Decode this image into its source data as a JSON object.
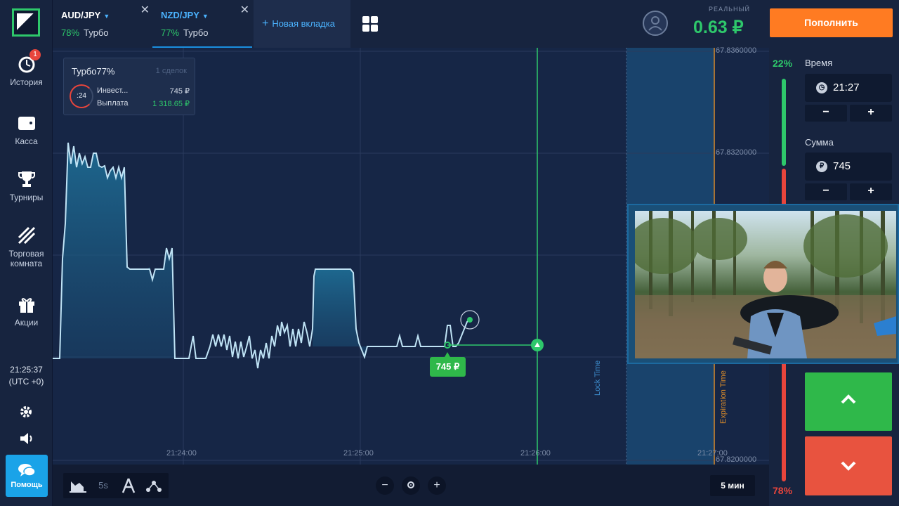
{
  "sidebar": {
    "history_label": "История",
    "history_badge": "1",
    "cashier_label": "Касса",
    "tournaments_label": "Турниры",
    "trading_room_label_1": "Торговая",
    "trading_room_label_2": "комната",
    "promo_label": "Акции",
    "clock_time": "21:25:37",
    "clock_tz": "(UTC +0)",
    "help_label": "Помощь"
  },
  "tabs": [
    {
      "pair": "AUD/JPY",
      "percent": "78%",
      "mode": "Турбо",
      "active": false
    },
    {
      "pair": "NZD/JPY",
      "percent": "77%",
      "mode": "Турбо",
      "active": true
    }
  ],
  "new_tab_label": "Новая вкладка",
  "account": {
    "type_label": "РЕАЛЬНЫЙ",
    "balance": "0.63 ₽"
  },
  "deposit_label": "Пополнить",
  "deal_card": {
    "title": "Турбо77%",
    "count": "1 сделок",
    "timer": ":24",
    "invest_label": "Инвест...",
    "invest_value": "745 ₽",
    "payout_label": "Выплата",
    "payout_value": "1 318.65 ₽"
  },
  "chart_data": {
    "type": "area",
    "price_labels": [
      "67.8360000",
      "67.8320000",
      "67.8200000"
    ],
    "time_labels": [
      "21:24:00",
      "21:25:00",
      "21:26:00",
      "21:27:00"
    ],
    "lock_label": "Lock Time",
    "expiration_label": "Expiration Time",
    "trade_badge": "745 ₽"
  },
  "bottom": {
    "interval_label": "5s",
    "timeframe_label": "5 мин"
  },
  "right_panel": {
    "up_percent": "22%",
    "down_percent": "78%",
    "up_fraction": 0.22,
    "time_label": "Время",
    "time_value": "21:27",
    "amount_label": "Сумма",
    "amount_value": "745",
    "currency_symbol": "₽"
  },
  "colors": {
    "green": "#2ec86b",
    "red": "#e8453c",
    "orange": "#ff7b22",
    "accent_blue": "#4bb3ff"
  }
}
